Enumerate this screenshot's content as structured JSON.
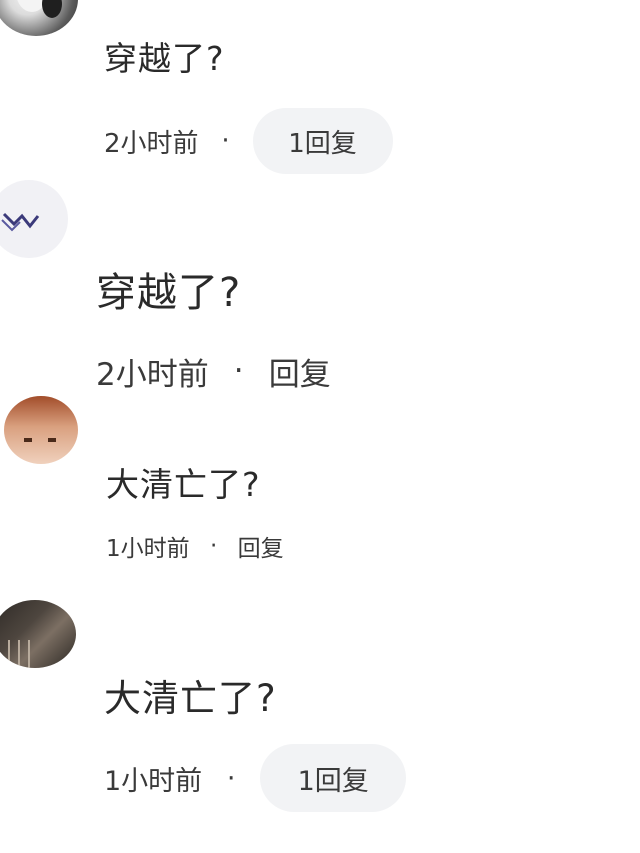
{
  "comments": [
    {
      "text": "穿越了?",
      "time": "2小时前",
      "separator": "·",
      "reply_label": "1回复",
      "reply_style": "pill",
      "avatar_icon": "user-avatar-icon"
    },
    {
      "text": "穿越了?",
      "time": "2小时前",
      "separator": "·",
      "reply_label": "回复",
      "reply_style": "plain",
      "avatar_icon": "user-avatar-icon"
    },
    {
      "text": "大清亡了?",
      "time": "1小时前",
      "separator": "·",
      "reply_label": "回复",
      "reply_style": "plain",
      "avatar_icon": "user-avatar-icon"
    },
    {
      "text": "大清亡了?",
      "time": "1小时前",
      "separator": "·",
      "reply_label": "1回复",
      "reply_style": "pill",
      "avatar_icon": "user-avatar-icon"
    }
  ],
  "colors": {
    "text": "#2a2a2a",
    "meta": "#3a3a3a",
    "pill_bg": "#f2f3f5",
    "background": "#ffffff"
  }
}
